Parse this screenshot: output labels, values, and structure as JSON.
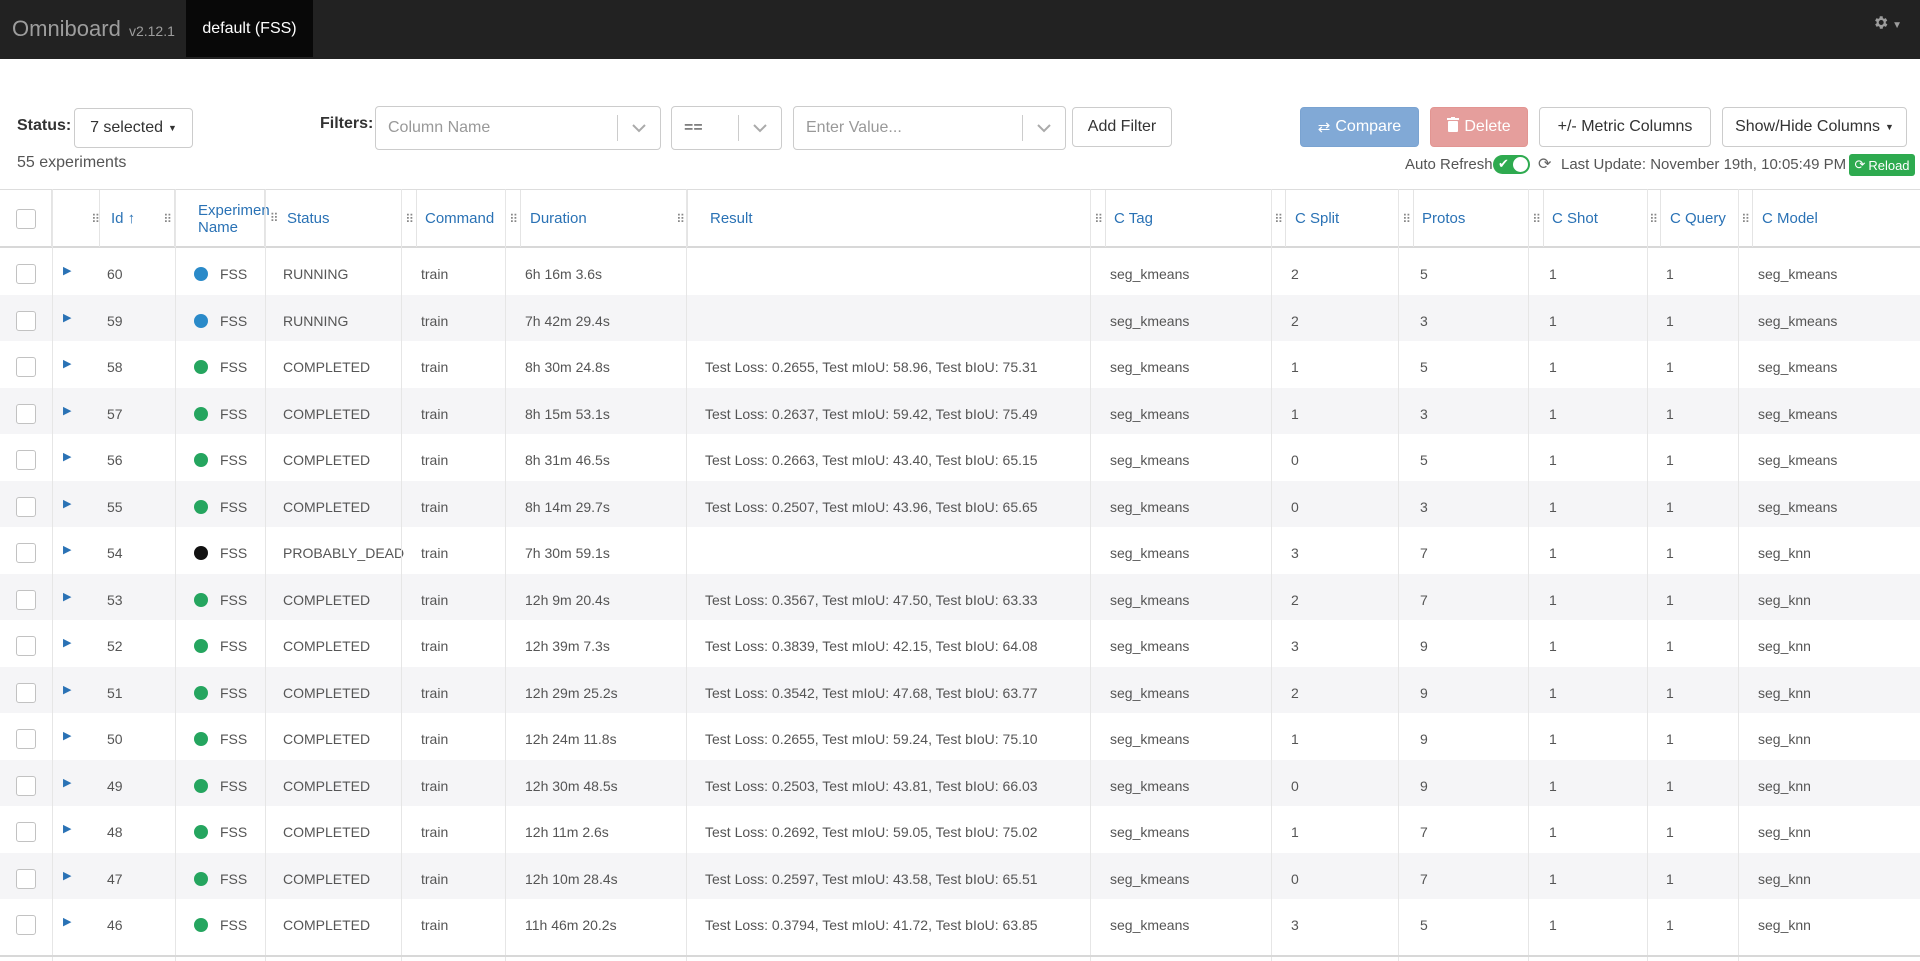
{
  "navbar": {
    "brand": "Omniboard",
    "version": "v2.12.1",
    "db_tab": "default (FSS)",
    "settings_icon": "gear-icon"
  },
  "toolbar": {
    "status_label": "Status:",
    "status_value": "7 selected",
    "filters_label": "Filters:",
    "column_placeholder": "Column Name",
    "operator_value": "==",
    "value_placeholder": "Enter Value...",
    "add_filter": "Add Filter",
    "compare": "Compare",
    "delete": "Delete",
    "metric_columns": "+/- Metric Columns",
    "show_hide_columns": "Show/Hide Columns",
    "experiment_count": "55 experiments",
    "auto_refresh_label": "Auto Refresh",
    "auto_refresh_on": true,
    "last_update": "Last Update: November 19th, 10:05:49 PM",
    "reload": "Reload"
  },
  "table": {
    "columns": {
      "id": "Id ↑",
      "name_line1": "Experimen",
      "name_line2": "Name",
      "status": "Status",
      "command": "Command",
      "duration": "Duration",
      "result": "Result",
      "c_tag": "C Tag",
      "c_split": "C Split",
      "protos": "Protos",
      "c_shot": "C Shot",
      "c_query": "C Query",
      "c_model": "C Model"
    },
    "colors": {
      "running": "#2a8ac9",
      "completed": "#25a55f",
      "probably_dead": "#111111"
    },
    "rows": [
      {
        "id": "60",
        "name": "FSS",
        "status": "RUNNING",
        "dot": "running",
        "command": "train",
        "duration": "6h 16m 3.6s",
        "result": "",
        "c_tag": "seg_kmeans",
        "c_split": "2",
        "protos": "5",
        "c_shot": "1",
        "c_query": "1",
        "c_model": "seg_kmeans"
      },
      {
        "id": "59",
        "name": "FSS",
        "status": "RUNNING",
        "dot": "running",
        "command": "train",
        "duration": "7h 42m 29.4s",
        "result": "",
        "c_tag": "seg_kmeans",
        "c_split": "2",
        "protos": "3",
        "c_shot": "1",
        "c_query": "1",
        "c_model": "seg_kmeans"
      },
      {
        "id": "58",
        "name": "FSS",
        "status": "COMPLETED",
        "dot": "completed",
        "command": "train",
        "duration": "8h 30m 24.8s",
        "result": "Test Loss: 0.2655, Test mIoU: 58.96, Test bIoU: 75.31",
        "c_tag": "seg_kmeans",
        "c_split": "1",
        "protos": "5",
        "c_shot": "1",
        "c_query": "1",
        "c_model": "seg_kmeans"
      },
      {
        "id": "57",
        "name": "FSS",
        "status": "COMPLETED",
        "dot": "completed",
        "command": "train",
        "duration": "8h 15m 53.1s",
        "result": "Test Loss: 0.2637, Test mIoU: 59.42, Test bIoU: 75.49",
        "c_tag": "seg_kmeans",
        "c_split": "1",
        "protos": "3",
        "c_shot": "1",
        "c_query": "1",
        "c_model": "seg_kmeans"
      },
      {
        "id": "56",
        "name": "FSS",
        "status": "COMPLETED",
        "dot": "completed",
        "command": "train",
        "duration": "8h 31m 46.5s",
        "result": "Test Loss: 0.2663, Test mIoU: 43.40, Test bIoU: 65.15",
        "c_tag": "seg_kmeans",
        "c_split": "0",
        "protos": "5",
        "c_shot": "1",
        "c_query": "1",
        "c_model": "seg_kmeans"
      },
      {
        "id": "55",
        "name": "FSS",
        "status": "COMPLETED",
        "dot": "completed",
        "command": "train",
        "duration": "8h 14m 29.7s",
        "result": "Test Loss: 0.2507, Test mIoU: 43.96, Test bIoU: 65.65",
        "c_tag": "seg_kmeans",
        "c_split": "0",
        "protos": "3",
        "c_shot": "1",
        "c_query": "1",
        "c_model": "seg_kmeans"
      },
      {
        "id": "54",
        "name": "FSS",
        "status": "PROBABLY_DEAD",
        "dot": "probably_dead",
        "command": "train",
        "duration": "7h 30m 59.1s",
        "result": "",
        "c_tag": "seg_kmeans",
        "c_split": "3",
        "protos": "7",
        "c_shot": "1",
        "c_query": "1",
        "c_model": "seg_knn"
      },
      {
        "id": "53",
        "name": "FSS",
        "status": "COMPLETED",
        "dot": "completed",
        "command": "train",
        "duration": "12h 9m 20.4s",
        "result": "Test Loss: 0.3567, Test mIoU: 47.50, Test bIoU: 63.33",
        "c_tag": "seg_kmeans",
        "c_split": "2",
        "protos": "7",
        "c_shot": "1",
        "c_query": "1",
        "c_model": "seg_knn"
      },
      {
        "id": "52",
        "name": "FSS",
        "status": "COMPLETED",
        "dot": "completed",
        "command": "train",
        "duration": "12h 39m 7.3s",
        "result": "Test Loss: 0.3839, Test mIoU: 42.15, Test bIoU: 64.08",
        "c_tag": "seg_kmeans",
        "c_split": "3",
        "protos": "9",
        "c_shot": "1",
        "c_query": "1",
        "c_model": "seg_knn"
      },
      {
        "id": "51",
        "name": "FSS",
        "status": "COMPLETED",
        "dot": "completed",
        "command": "train",
        "duration": "12h 29m 25.2s",
        "result": "Test Loss: 0.3542, Test mIoU: 47.68, Test bIoU: 63.77",
        "c_tag": "seg_kmeans",
        "c_split": "2",
        "protos": "9",
        "c_shot": "1",
        "c_query": "1",
        "c_model": "seg_knn"
      },
      {
        "id": "50",
        "name": "FSS",
        "status": "COMPLETED",
        "dot": "completed",
        "command": "train",
        "duration": "12h 24m 11.8s",
        "result": "Test Loss: 0.2655, Test mIoU: 59.24, Test bIoU: 75.10",
        "c_tag": "seg_kmeans",
        "c_split": "1",
        "protos": "9",
        "c_shot": "1",
        "c_query": "1",
        "c_model": "seg_knn"
      },
      {
        "id": "49",
        "name": "FSS",
        "status": "COMPLETED",
        "dot": "completed",
        "command": "train",
        "duration": "12h 30m 48.5s",
        "result": "Test Loss: 0.2503, Test mIoU: 43.81, Test bIoU: 66.03",
        "c_tag": "seg_kmeans",
        "c_split": "0",
        "protos": "9",
        "c_shot": "1",
        "c_query": "1",
        "c_model": "seg_knn"
      },
      {
        "id": "48",
        "name": "FSS",
        "status": "COMPLETED",
        "dot": "completed",
        "command": "train",
        "duration": "12h 11m 2.6s",
        "result": "Test Loss: 0.2692, Test mIoU: 59.05, Test bIoU: 75.02",
        "c_tag": "seg_kmeans",
        "c_split": "1",
        "protos": "7",
        "c_shot": "1",
        "c_query": "1",
        "c_model": "seg_knn"
      },
      {
        "id": "47",
        "name": "FSS",
        "status": "COMPLETED",
        "dot": "completed",
        "command": "train",
        "duration": "12h 10m 28.4s",
        "result": "Test Loss: 0.2597, Test mIoU: 43.58, Test bIoU: 65.51",
        "c_tag": "seg_kmeans",
        "c_split": "0",
        "protos": "7",
        "c_shot": "1",
        "c_query": "1",
        "c_model": "seg_knn"
      },
      {
        "id": "46",
        "name": "FSS",
        "status": "COMPLETED",
        "dot": "completed",
        "command": "train",
        "duration": "11h 46m 20.2s",
        "result": "Test Loss: 0.3794, Test mIoU: 41.72, Test bIoU: 63.85",
        "c_tag": "seg_kmeans",
        "c_split": "3",
        "protos": "5",
        "c_shot": "1",
        "c_query": "1",
        "c_model": "seg_knn"
      }
    ]
  }
}
